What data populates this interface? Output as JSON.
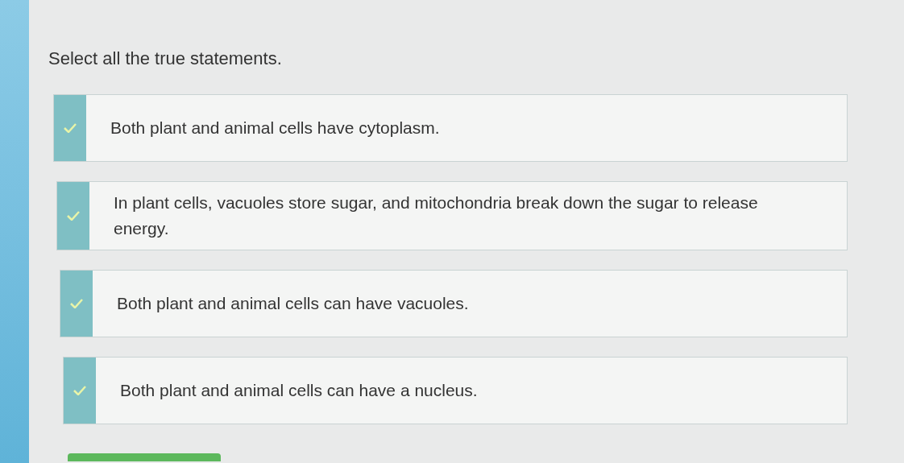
{
  "question": {
    "prompt": "Select all the true statements."
  },
  "options": [
    {
      "text": "Both plant and animal cells have cytoplasm.",
      "selected": true
    },
    {
      "text": "In plant cells, vacuoles store sugar, and mitochondria break down the sugar to release energy.",
      "selected": true
    },
    {
      "text": "Both plant and animal cells can have vacuoles.",
      "selected": true
    },
    {
      "text": "Both plant and animal cells can have a nucleus.",
      "selected": true
    }
  ]
}
